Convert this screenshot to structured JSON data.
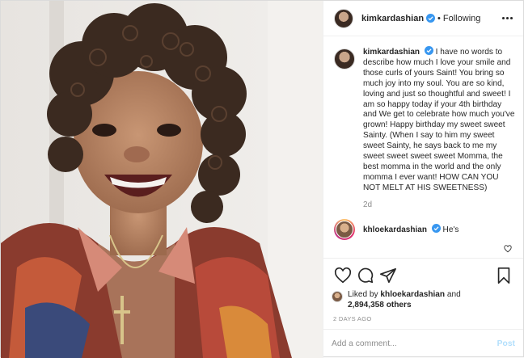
{
  "header": {
    "username": "kimkardashian",
    "separator": "•",
    "follow_status": "Following",
    "more_icon": "more-options-icon"
  },
  "caption": {
    "username": "kimkardashian",
    "text": "I have no words to describe how much I love your smile and those curls of yours Saint! You bring so much joy into my soul. You are so kind, loving and just so thoughtful and sweet! I am so happy today if your 4th birthday and We get to celebrate how much you've grown! Happy birthday my sweet sweet Sainty. (When I say to him my sweet sweet Sainty, he says back to me my sweet sweet sweet sweet Momma, the best momma in the world and the only momma I ever want! HOW CAN YOU NOT MELT AT HIS SWEETNESS)",
    "time": "2d"
  },
  "comment": {
    "username": "khloekardashian",
    "text": "He's"
  },
  "actions": {
    "icons": [
      "heart-icon",
      "comment-icon",
      "share-icon",
      "bookmark-icon"
    ]
  },
  "likes": {
    "prefix": "Liked by",
    "user": "khloekardashian",
    "connector": "and",
    "count": "2,894,358 others",
    "age": "2 DAYS AGO"
  },
  "add_comment": {
    "placeholder": "Add a comment...",
    "post_label": "Post"
  },
  "colors": {
    "verified": "#3897f0",
    "border": "#dbdbdb",
    "muted": "#8e8e8e",
    "post_disabled": "#b2dffc"
  }
}
